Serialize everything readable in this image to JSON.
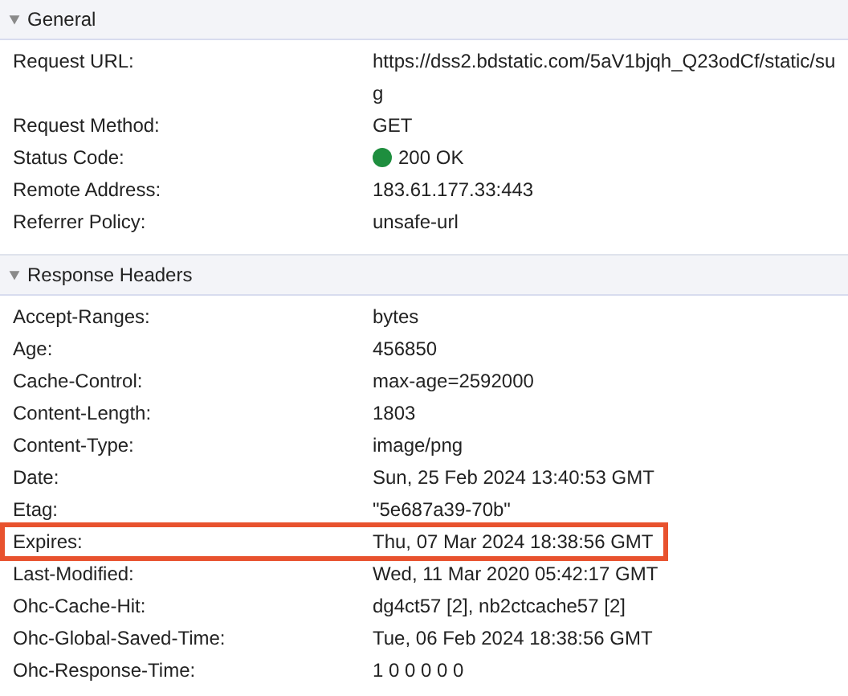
{
  "sections": [
    {
      "title": "General",
      "expanded": true,
      "rows": [
        {
          "name": "Request URL:",
          "value": [
            "https://dss2.bdstatic.com/5aV1bjqh_Q23odCf/static/su",
            "g"
          ],
          "highlighted": false
        },
        {
          "name": "Request Method:",
          "value": [
            "GET"
          ],
          "highlighted": false
        },
        {
          "name": "Status Code:",
          "value": [
            "200 OK"
          ],
          "color": "#1e8e3e",
          "highlighted": false
        },
        {
          "name": "Remote Address:",
          "value": [
            "183.61.177.33:443"
          ],
          "highlighted": false
        },
        {
          "name": "Referrer Policy:",
          "value": [
            "unsafe-url"
          ],
          "highlighted": false
        }
      ]
    },
    {
      "title": "Response Headers",
      "expanded": true,
      "rows": [
        {
          "name": "Accept-Ranges:",
          "value": [
            "bytes"
          ],
          "highlighted": false
        },
        {
          "name": "Age:",
          "value": [
            "456850"
          ],
          "highlighted": false
        },
        {
          "name": "Cache-Control:",
          "value": [
            "max-age=2592000"
          ],
          "highlighted": false
        },
        {
          "name": "Content-Length:",
          "value": [
            "1803"
          ],
          "highlighted": false
        },
        {
          "name": "Content-Type:",
          "value": [
            "image/png"
          ],
          "highlighted": false
        },
        {
          "name": "Date:",
          "value": [
            "Sun, 25 Feb 2024 13:40:53 GMT"
          ],
          "highlighted": false
        },
        {
          "name": "Etag:",
          "value": [
            "\"5e687a39-70b\""
          ],
          "highlighted": false
        },
        {
          "name": "Expires:",
          "value": [
            "Thu, 07 Mar 2024 18:38:56 GMT"
          ],
          "highlighted": true
        },
        {
          "name": "Last-Modified:",
          "value": [
            "Wed, 11 Mar 2020 05:42:17 GMT"
          ],
          "highlighted": false
        },
        {
          "name": "Ohc-Cache-Hit:",
          "value": [
            "dg4ct57 [2], nb2ctcache57 [2]"
          ],
          "highlighted": false
        },
        {
          "name": "Ohc-Global-Saved-Time:",
          "value": [
            "Tue, 06 Feb 2024 18:38:56 GMT"
          ],
          "highlighted": false
        },
        {
          "name": "Ohc-Response-Time:",
          "value": [
            "1 0 0 0 0 0"
          ],
          "highlighted": false
        }
      ]
    }
  ]
}
